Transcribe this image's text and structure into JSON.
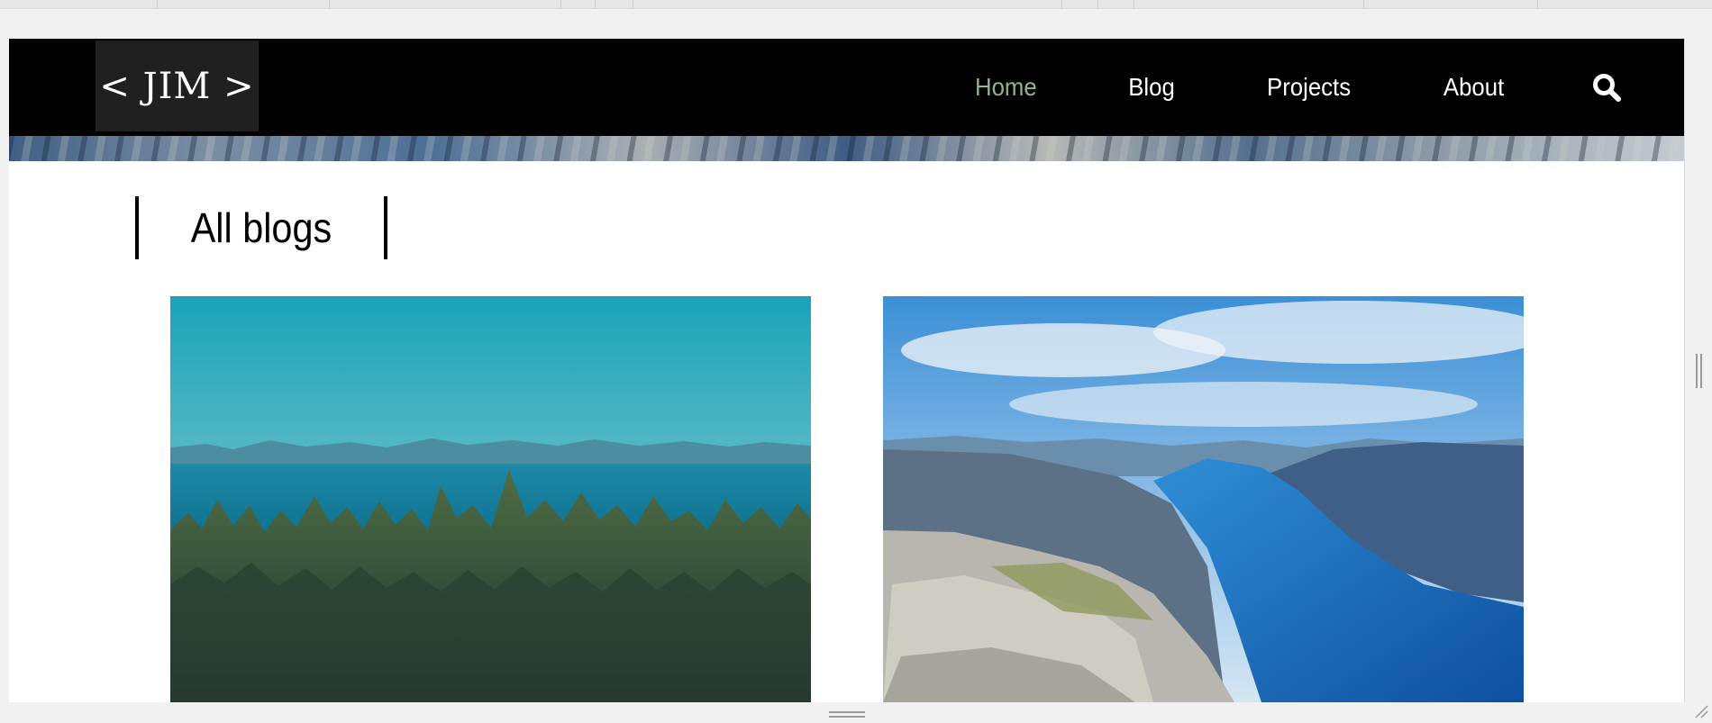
{
  "site": {
    "logo_text": "< JIM >"
  },
  "nav": {
    "items": [
      {
        "label": "Home",
        "active": true
      },
      {
        "label": "Blog",
        "active": false
      },
      {
        "label": "Projects",
        "active": false
      },
      {
        "label": "About",
        "active": false
      }
    ],
    "search_icon": "search-icon",
    "active_color": "#8fb58a"
  },
  "main": {
    "section_title": "All blogs",
    "cards": [
      {
        "image": "forest-and-sea-landscape"
      },
      {
        "image": "fjord-cliff-landscape"
      }
    ]
  },
  "colors": {
    "nav_background": "#000000",
    "logo_background": "#202020",
    "page_background": "#ffffff"
  }
}
